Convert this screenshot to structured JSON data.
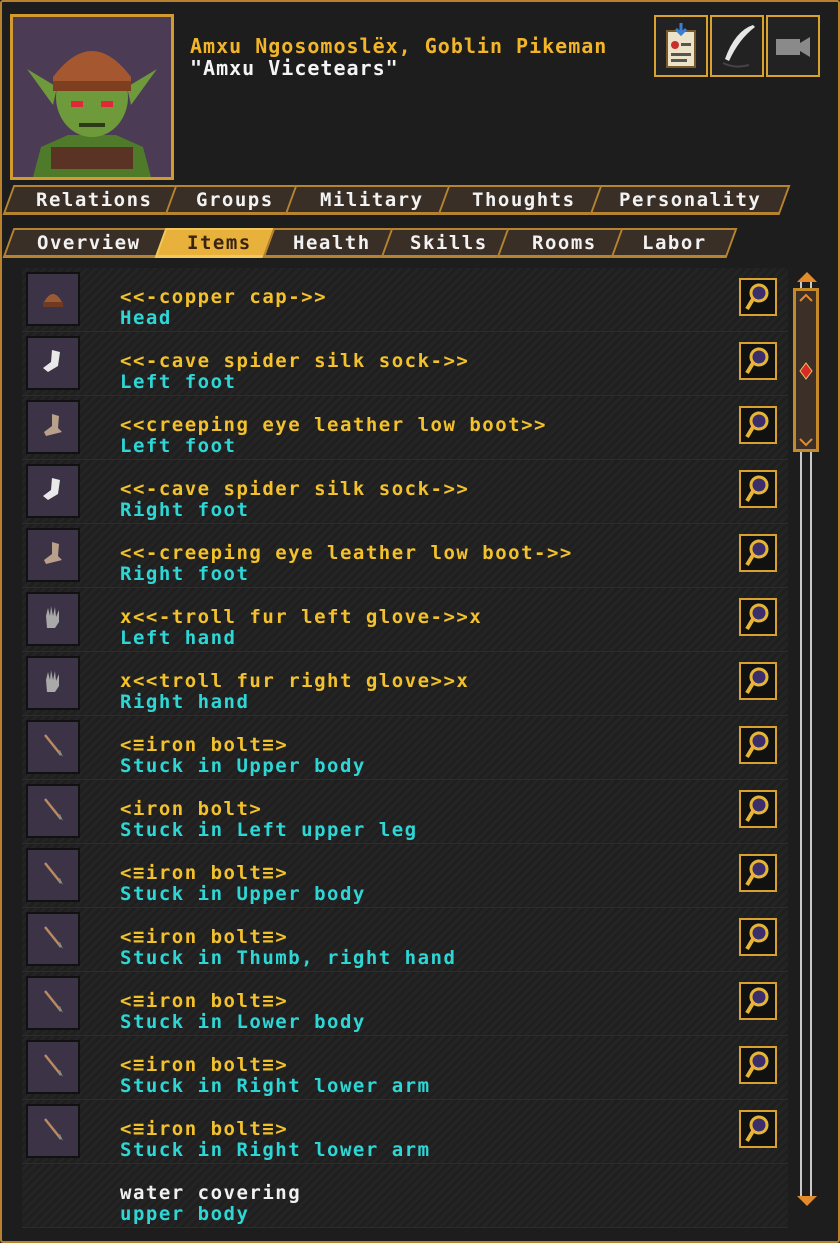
{
  "header": {
    "name": "Amxu Ngosomoslëx, Goblin Pikeman",
    "nickname": "\"Amxu Vicetears\"",
    "buttons": [
      {
        "icon": "dossier-icon"
      },
      {
        "icon": "quill-icon"
      },
      {
        "icon": "camera-icon"
      }
    ]
  },
  "tabs_top": [
    "Relations",
    "Groups",
    "Military",
    "Thoughts",
    "Personality"
  ],
  "tabs_bottom": [
    "Overview",
    "Items",
    "Health",
    "Skills",
    "Rooms",
    "Labor"
  ],
  "active_tab": "Items",
  "items": [
    {
      "name": "<<-copper cap->>",
      "location": "Head",
      "icon": "cap-icon"
    },
    {
      "name": "<<-cave spider silk sock->>",
      "location": "Left foot",
      "icon": "sock-icon"
    },
    {
      "name": "<<creeping eye leather low boot>>",
      "location": "Left foot",
      "icon": "boot-icon"
    },
    {
      "name": "<<-cave spider silk sock->>",
      "location": "Right foot",
      "icon": "sock-icon"
    },
    {
      "name": "<<-creeping eye leather low boot->>",
      "location": "Right foot",
      "icon": "boot-icon"
    },
    {
      "name": "x<<-troll fur left glove->>x",
      "location": "Left hand",
      "icon": "glove-icon"
    },
    {
      "name": "x<<troll fur right glove>>x",
      "location": "Right hand",
      "icon": "glove-icon"
    },
    {
      "name": "<≡iron bolt≡>",
      "location": "Stuck in Upper body",
      "icon": "bolt-icon"
    },
    {
      "name": "<iron bolt>",
      "location": "Stuck in Left upper leg",
      "icon": "bolt-icon"
    },
    {
      "name": "<≡iron bolt≡>",
      "location": "Stuck in Upper body",
      "icon": "bolt-icon"
    },
    {
      "name": "<≡iron bolt≡>",
      "location": "Stuck in Thumb, right hand",
      "icon": "bolt-icon"
    },
    {
      "name": "<≡iron bolt≡>",
      "location": "Stuck in Lower body",
      "icon": "bolt-icon"
    },
    {
      "name": "<≡iron bolt≡>",
      "location": "Stuck in Right lower arm",
      "icon": "bolt-icon"
    },
    {
      "name": "<≡iron bolt≡>",
      "location": "Stuck in Right lower arm",
      "icon": "bolt-icon"
    },
    {
      "name": "water covering",
      "location": "upper body",
      "icon": ""
    }
  ],
  "colors": {
    "gold": "#f2c12c",
    "cyan": "#2fd6d6",
    "frame": "#b8812e"
  }
}
